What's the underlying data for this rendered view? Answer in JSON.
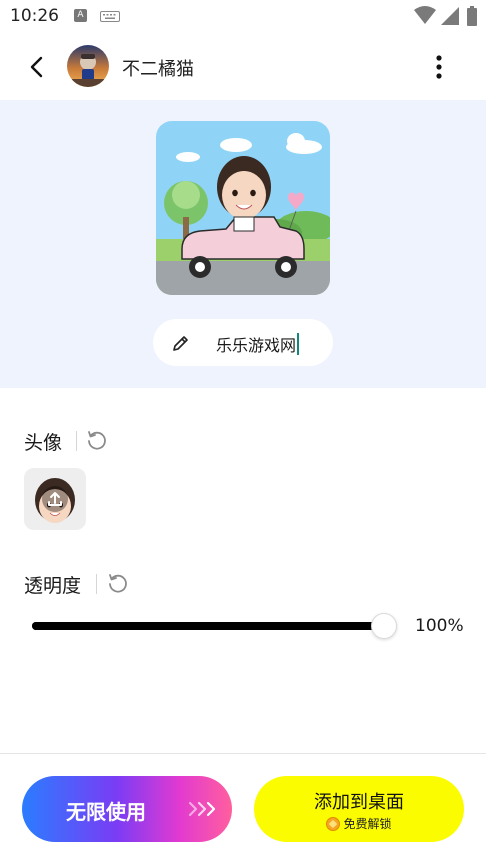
{
  "status_bar": {
    "time": "10:26",
    "a_badge": "A",
    "icons": [
      "a-notification-icon",
      "keyboard-icon",
      "wifi-icon",
      "signal-icon",
      "battery-icon"
    ]
  },
  "header": {
    "title": "不二橘猫",
    "back_icon": "back-arrow-icon",
    "more_icon": "more-vertical-icon"
  },
  "preview": {
    "name_value": "乐乐游戏网",
    "edit_icon": "pencil-icon"
  },
  "avatar_section": {
    "label": "头像",
    "reset_icon": "reset-icon",
    "upload_icon": "upload-icon"
  },
  "opacity_section": {
    "label": "透明度",
    "reset_icon": "reset-icon",
    "value": 1.0,
    "value_label": "100%"
  },
  "bottom_actions": {
    "unlimited_label": "无限使用",
    "add_label": "添加到桌面",
    "add_sub_label": "免费解锁"
  },
  "colors": {
    "preview_bg": "#eff3fd",
    "add_button": "#fcfc00",
    "gradient_start": "#2a7dff",
    "gradient_end": "#ff5f9e",
    "caret": "#0f8a7a"
  }
}
